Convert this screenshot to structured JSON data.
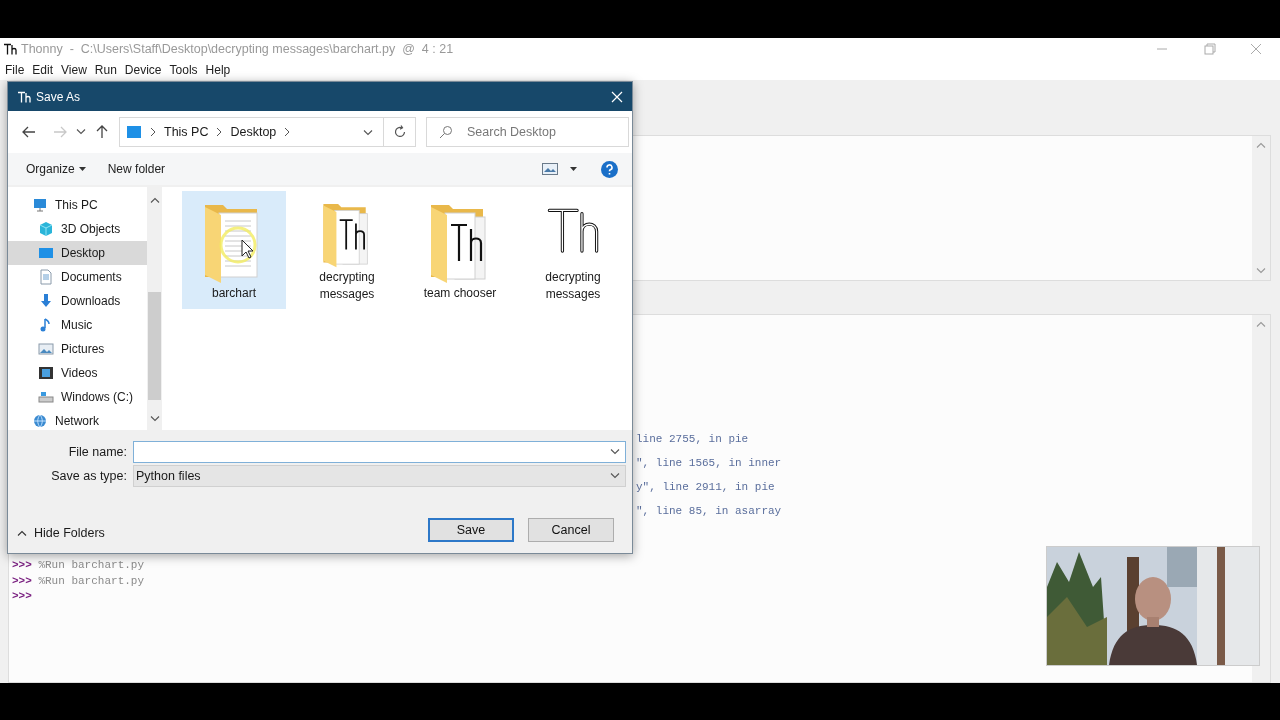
{
  "window": {
    "title": "Thonny  -  C:\\Users\\Staff\\Desktop\\decrypting messages\\barchart.py  @  4 : 21"
  },
  "menu": [
    "File",
    "Edit",
    "View",
    "Run",
    "Device",
    "Tools",
    "Help"
  ],
  "shell": {
    "traceback": [
      "line 2755, in pie",
      "\", line 1565, in inner",
      "y\", line 2911, in pie",
      "\", line 85, in asarray"
    ],
    "lines": [
      {
        "prompt": ">>>",
        "command": "%Run barchart.py"
      },
      {
        "prompt": ">>>",
        "command": "%Run barchart.py"
      },
      {
        "prompt": ">>>"
      }
    ]
  },
  "dialog": {
    "title": "Save As",
    "back": {
      "disabled": false
    },
    "forward": {
      "disabled": true
    },
    "breadcrumb": [
      "This PC",
      "Desktop"
    ],
    "search": {
      "placeholder": "Search Desktop"
    },
    "toolbar": {
      "organize": "Organize",
      "new_folder": "New folder"
    },
    "sidebar": {
      "items": [
        {
          "label": "This PC",
          "kind": "pc",
          "selected": false,
          "children": [
            {
              "label": "3D Objects",
              "kind": "objects",
              "selected": false
            },
            {
              "label": "Desktop",
              "kind": "desktop",
              "selected": true
            },
            {
              "label": "Documents",
              "kind": "documents",
              "selected": false
            },
            {
              "label": "Downloads",
              "kind": "downloads",
              "selected": false
            },
            {
              "label": "Music",
              "kind": "music",
              "selected": false
            },
            {
              "label": "Pictures",
              "kind": "pictures",
              "selected": false
            },
            {
              "label": "Videos",
              "kind": "videos",
              "selected": false
            },
            {
              "label": "Windows (C:)",
              "kind": "drive",
              "selected": false
            }
          ]
        },
        {
          "label": "Network",
          "kind": "network",
          "selected": false
        }
      ]
    },
    "files": [
      {
        "name": "barchart",
        "kind": "folder-doc",
        "selected": true
      },
      {
        "name": "decrypting messages",
        "kind": "folder-thonny",
        "selected": false
      },
      {
        "name": "team chooser",
        "kind": "folder-thonny",
        "selected": false
      },
      {
        "name": "decrypting messages",
        "kind": "thonny-file",
        "selected": false
      }
    ],
    "file_name": {
      "label": "File name:"
    },
    "save_as_type": {
      "label": "Save as type:",
      "value": "Python files"
    },
    "hide_folders": "Hide Folders",
    "buttons": [
      {
        "label": "Save",
        "default": true
      },
      {
        "label": "Cancel",
        "default": false
      }
    ]
  },
  "webcam": {
    "kind": "picture"
  }
}
